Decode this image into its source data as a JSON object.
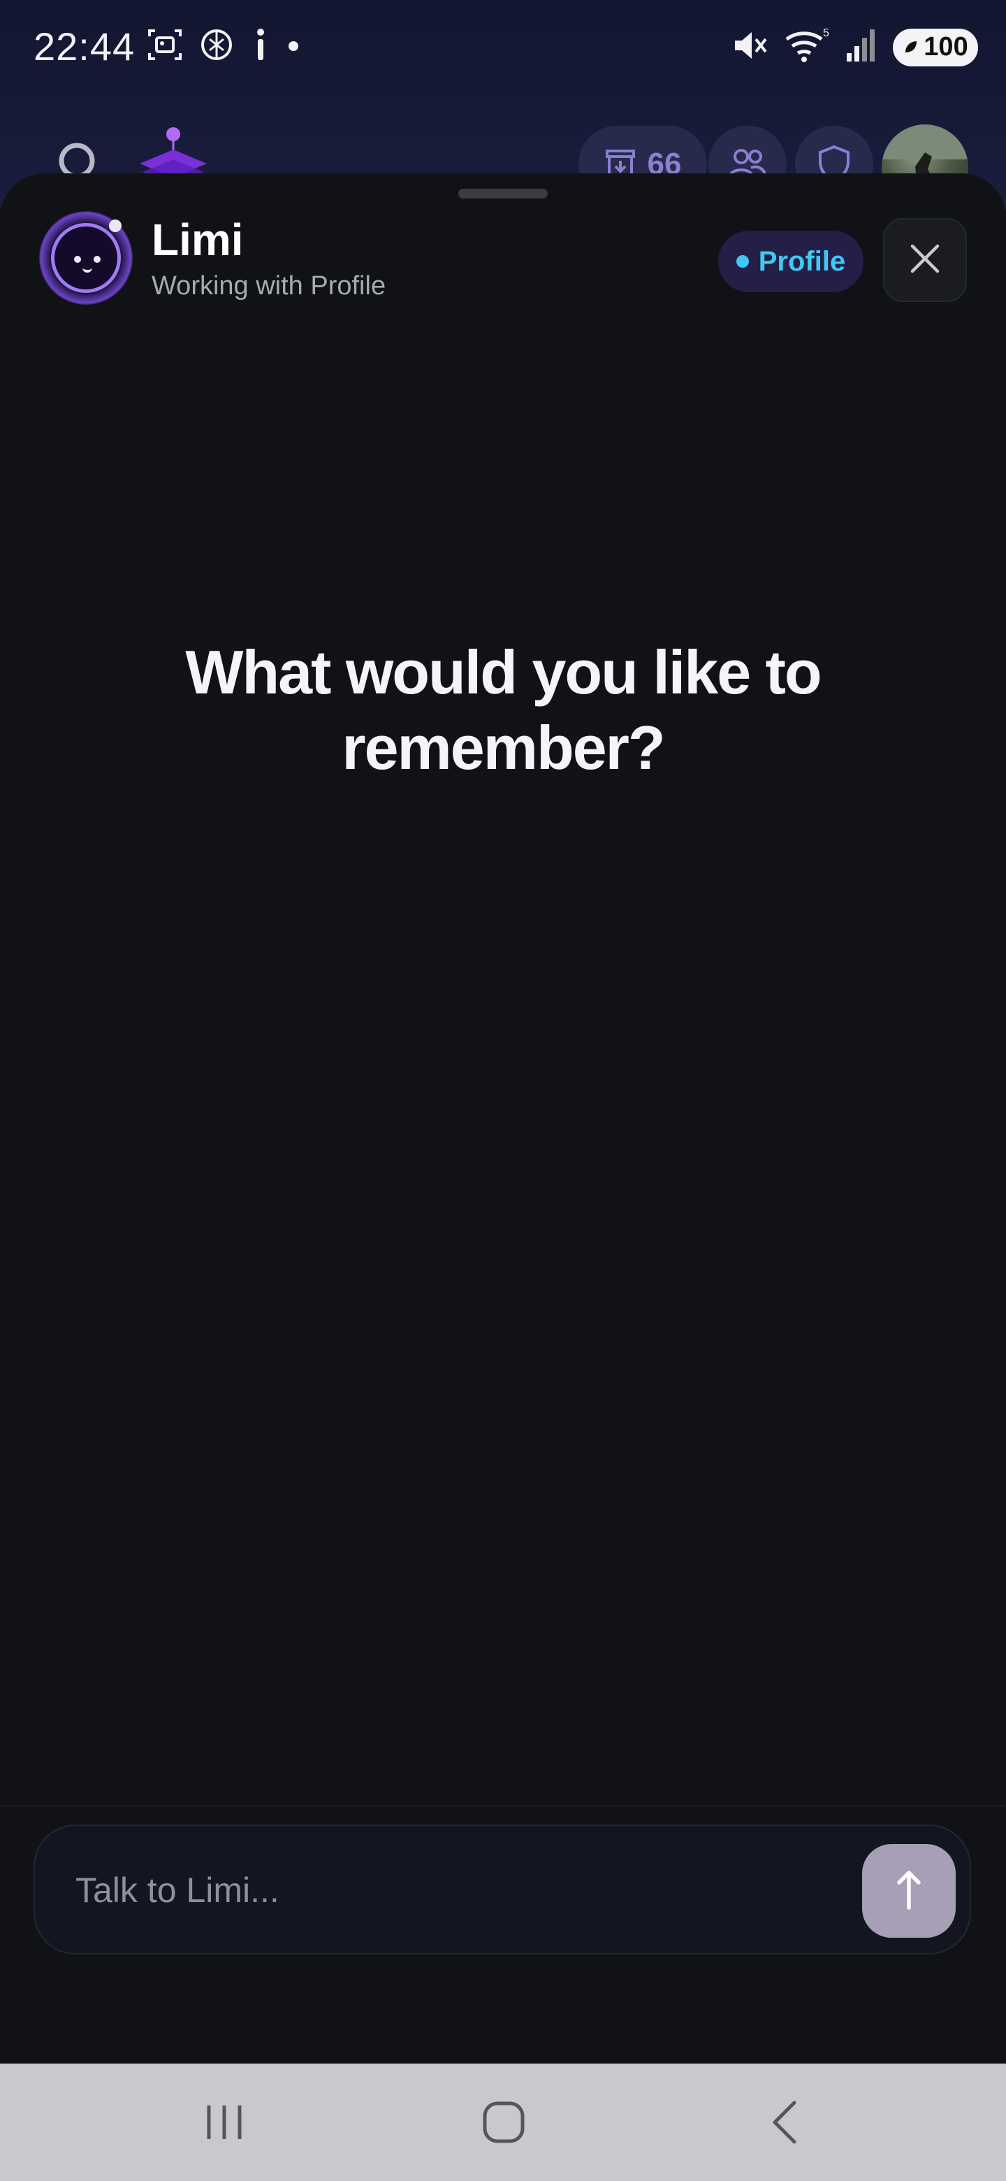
{
  "status_bar": {
    "time": "22:44",
    "left_icons": [
      "screenshot-icon",
      "chatgpt-icon",
      "info-icon",
      "notification-dot-icon"
    ],
    "right_icons": [
      "mute-icon",
      "wifi-icon",
      "signal-icon",
      "battery-icon"
    ],
    "wifi_superscript": "5",
    "battery_level": "100"
  },
  "background_app": {
    "inbox_count": "66",
    "icons": [
      "search-icon",
      "app-logo-icon",
      "inbox-icon",
      "people-icon",
      "shield-icon",
      "avatar"
    ]
  },
  "assistant": {
    "name": "Limi",
    "subtitle": "Working with Profile",
    "context_chip": "Profile",
    "accent_color": "#41c8f2"
  },
  "main": {
    "prompt": "What would you like to remember?"
  },
  "composer": {
    "placeholder": "Talk to Limi...",
    "value": ""
  },
  "nav_bar": {
    "buttons": [
      "recents-icon",
      "home-icon",
      "back-icon"
    ]
  }
}
